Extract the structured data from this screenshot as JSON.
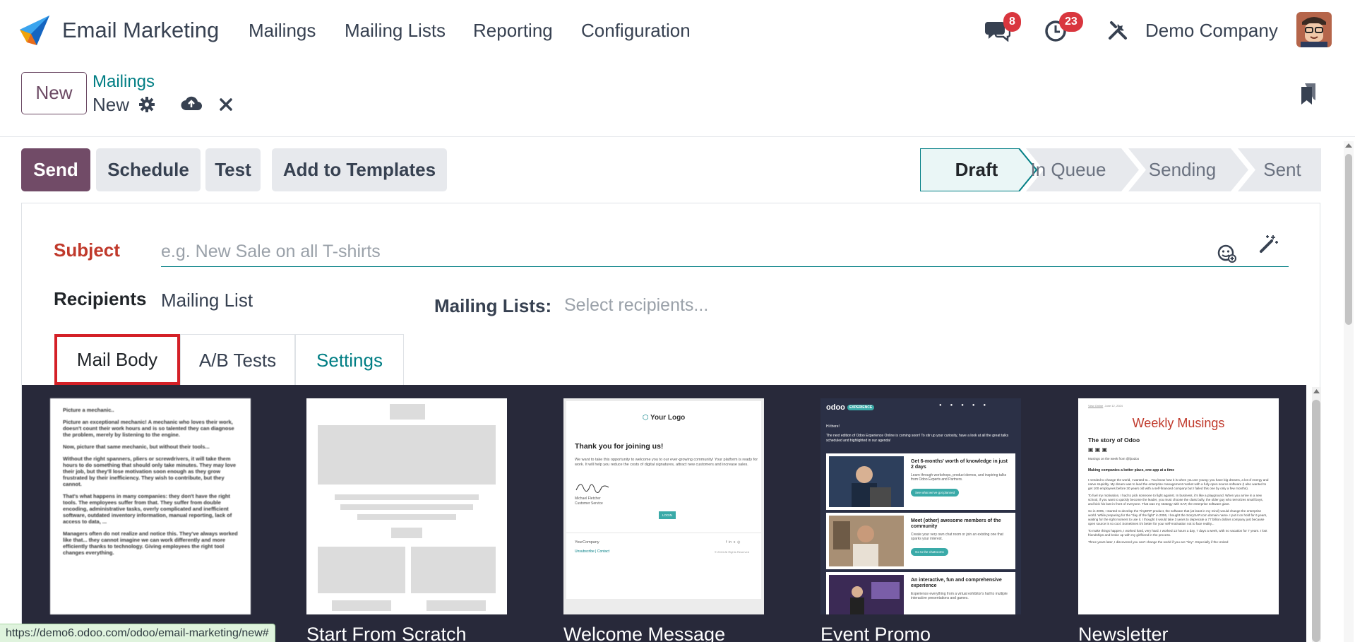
{
  "app": {
    "name": "Email Marketing"
  },
  "menu": [
    "Mailings",
    "Mailing Lists",
    "Reporting",
    "Configuration"
  ],
  "systray": {
    "messages_count": "8",
    "activities_count": "23",
    "company": "Demo Company"
  },
  "control_panel": {
    "new_button": "New",
    "breadcrumb_parent": "Mailings",
    "breadcrumb_current": "New"
  },
  "actions": {
    "send": "Send",
    "schedule": "Schedule",
    "test": "Test",
    "add_to_templates": "Add to Templates"
  },
  "stages": [
    "Draft",
    "In Queue",
    "Sending",
    "Sent"
  ],
  "active_stage": "Draft",
  "form": {
    "subject_label": "Subject",
    "subject_value": "",
    "subject_placeholder": "e.g. New Sale on all T-shirts",
    "recipients_label": "Recipients",
    "recipients_value": "Mailing List",
    "mailing_lists_label": "Mailing Lists:",
    "mailing_lists_placeholder": "Select recipients..."
  },
  "tabs": [
    "Mail Body",
    "A/B Tests",
    "Settings"
  ],
  "active_tab": "Mail Body",
  "templates": [
    {
      "name": "",
      "preview_lines": [
        "Picture a mechanic..",
        "Picture an exceptional mechanic! A mechanic who loves their work, doesn't count their work hours and is so talented they can diagnose the problem, merely by listening to the engine.",
        "Now, picture that same mechanic, but without their tools...",
        "Without the right spanners, pliers or screwdrivers, it will take them hours to do something that should only take minutes. They may love their job, but they'll lose motivation soon enough as they grow frustrated by their inefficiency. They wish to contribute, but they cannot.",
        "That's what happens in many companies: they don't have the right tools. The employees suffer from that. They suffer from double encoding, administrative tasks, overly complicated and inefficient software, outdated inventory information, manual reporting, lack of access to data, ...",
        "Managers often do not realize and notice this. They've always worked like that... they cannot imagine we can work differently and more efficiently thanks to technology. Giving employees the right tool changes everything."
      ]
    },
    {
      "name": "Start From Scratch"
    },
    {
      "name": "Welcome Message",
      "logo": "Your Logo",
      "heading": "Thank you for joining us!",
      "body": "We want to take this opportunity to welcome you to our ever-growing community! Your platform is ready for work. It will help you reduce the costs of digital signatures, attract new customers and increase sales.",
      "signer": "Michael Fletcher",
      "signer_role": "Customer Service",
      "button": "LOGIN",
      "company": "YourCompany",
      "footer_links": "Unsubscribe | Contact",
      "copyright": "© 2024 All Rights Reserved"
    },
    {
      "name": "Event Promo",
      "brand": "odoo",
      "brand_tag": "EXPERIENCE",
      "greeting": "Hi there!",
      "intro": "The next edition of Odoo Experience Online is coming soon! To stir up your curiosity, have a look at all the great talks scheduled and highlighted in our agenda!",
      "items": [
        {
          "title": "Get 6-months' worth of knowledge in just 2 days",
          "text": "Learn through workshops, product demos, and inspiring talks from Odoo Experts and Partners.",
          "button": "See what we've got planned"
        },
        {
          "title": "Meet (other) awesome members of the community",
          "text": "Create your very own chat room or join an existing one that sparks your interest.",
          "button": "Go to the chatrooms"
        },
        {
          "title": "An interactive, fun and comprehensive experience",
          "text": "Experience everything from a virtual exhibitor's hall to multiple interactive presentations and games.",
          "button": ""
        }
      ]
    },
    {
      "name": "Newsletter",
      "view_online": "View Online",
      "date": "June 12, 2024",
      "title": "Weekly Musings",
      "subtitle": "The story of Odoo",
      "from": "Musings on the week from @fpodoo",
      "section": "Making companies a better place, one app at a time",
      "paragraphs": [
        "I needed to change the world, I wanted to... You know how it is when you are young: you have big dreams, a lot of energy and naïve stupidity. My dream was to lead the enterprise management market with a fully open source software (I also wanted to get 100 employees before 30 years old with a self-financed company but I failed this one by only a few months).",
        "To fuel my motivation, I had to pick someone to fight against. In business, it's like a playground. When you arrive in a new school, if you want to quickly become the leader, you must choose the class bully, the older guy who terrorizes small boys, and kick his butt in front of everyone. That was my strategy with SAP, the enterprise software giant.",
        "So in 2005, I started to develop the TinyERP product, the software that (at least in my mind) would change the enterprise world. While preparing for the \"day of the fight\" in 2006, I bought the SorrySAP.com domain name. I put it on hold for 6 years, waiting for the right moment to use it. I thought it would take 3 years to deprecate a 77 billion dollars company just because open source is so cool. Sometimes it's better for your self-motivation not to face reality...",
        "To make things happen, I worked hard, very hard. I worked 13 hours a day, 7 days a week, with no vacation for 7 years. I lost friendships and broke up with my girlfriend in the process.",
        "Three years later, I discovered you can't change the world if you are \"tiny\". Especially if the United"
      ]
    }
  ],
  "status_url": "https://demo6.odoo.com/odoo/email-marketing/new#",
  "colors": {
    "brand": "#714b67",
    "accent": "#017e84",
    "danger": "#d9363e",
    "editor_bg": "#28293a"
  }
}
